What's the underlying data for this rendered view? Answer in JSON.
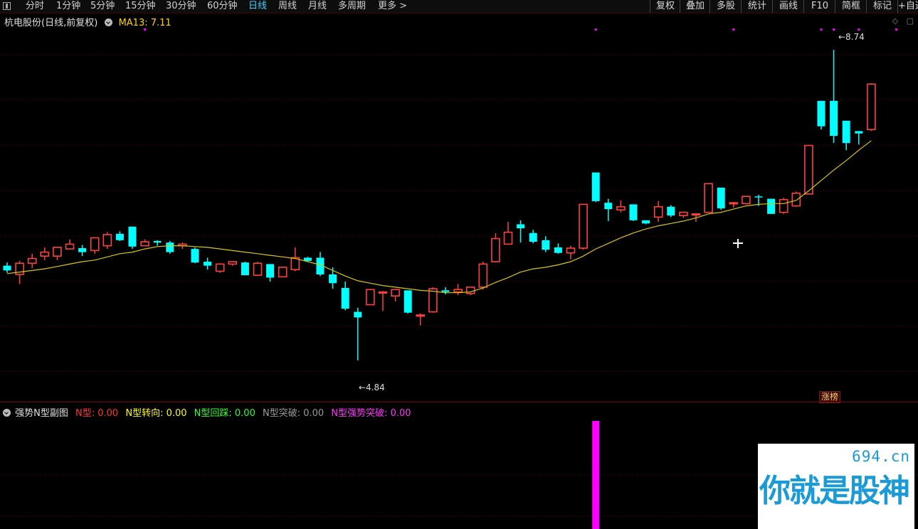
{
  "toolbar": {
    "periods": [
      "分时",
      "1分钟",
      "5分钟",
      "15分钟",
      "30分钟",
      "60分钟",
      "日线",
      "周线",
      "月线",
      "多周期",
      "更多 >"
    ],
    "active_period": "日线",
    "right_buttons": [
      "复权",
      "叠加",
      "多股",
      "统计",
      "画线",
      "F10",
      "简框",
      "标记",
      "+自选"
    ]
  },
  "header": {
    "stock": "杭电股份(日线,前复权)",
    "ma_label": "MA13: 7.11",
    "ma_color": "#ffd700"
  },
  "price_marks": {
    "high": "8.74",
    "low": "4.84"
  },
  "badge": "涨榜",
  "sub": {
    "title": "强势N型副图",
    "indicators": [
      {
        "label": "N型: 0.00",
        "color": "#ff3333"
      },
      {
        "label": "N型转向: 0.00",
        "color": "#ffff00"
      },
      {
        "label": "N型回踩: 0.00",
        "color": "#33ff33"
      },
      {
        "label": "N型突破: 0.00",
        "color": "#9a9a9a"
      },
      {
        "label": "N型强势突破: 0.00",
        "color": "#ff33ff"
      }
    ]
  },
  "watermark": {
    "url": "694.cn",
    "text": "你就是股神"
  },
  "colors": {
    "up": "#ff4040",
    "down": "#00ffff",
    "ma": "#d8c800",
    "grid": "#600000",
    "signal": "#ff00ff"
  },
  "chart_data": {
    "type": "candlestick",
    "price_range": [
      4.6,
      9.0
    ],
    "candles": [
      {
        "o": 6.03,
        "h": 6.07,
        "l": 5.94,
        "c": 5.97
      },
      {
        "o": 5.92,
        "h": 6.09,
        "l": 5.8,
        "c": 6.06
      },
      {
        "o": 6.06,
        "h": 6.18,
        "l": 6.0,
        "c": 6.12
      },
      {
        "o": 6.15,
        "h": 6.26,
        "l": 6.1,
        "c": 6.2
      },
      {
        "o": 6.15,
        "h": 6.24,
        "l": 6.1,
        "c": 6.26
      },
      {
        "o": 6.24,
        "h": 6.36,
        "l": 6.24,
        "c": 6.3
      },
      {
        "o": 6.25,
        "h": 6.29,
        "l": 6.15,
        "c": 6.2
      },
      {
        "o": 6.22,
        "h": 6.38,
        "l": 6.18,
        "c": 6.38
      },
      {
        "o": 6.28,
        "h": 6.45,
        "l": 6.24,
        "c": 6.42
      },
      {
        "o": 6.43,
        "h": 6.46,
        "l": 6.34,
        "c": 6.35
      },
      {
        "o": 6.52,
        "h": 6.52,
        "l": 6.24,
        "c": 6.27
      },
      {
        "o": 6.28,
        "h": 6.36,
        "l": 6.28,
        "c": 6.33
      },
      {
        "o": 6.34,
        "h": 6.35,
        "l": 6.28,
        "c": 6.32
      },
      {
        "o": 6.32,
        "h": 6.34,
        "l": 6.18,
        "c": 6.2
      },
      {
        "o": 6.28,
        "h": 6.32,
        "l": 6.24,
        "c": 6.3
      },
      {
        "o": 6.24,
        "h": 6.26,
        "l": 6.06,
        "c": 6.07
      },
      {
        "o": 6.08,
        "h": 6.13,
        "l": 5.98,
        "c": 6.03
      },
      {
        "o": 5.96,
        "h": 6.06,
        "l": 5.94,
        "c": 6.05
      },
      {
        "o": 6.05,
        "h": 6.08,
        "l": 6.03,
        "c": 6.08
      },
      {
        "o": 6.07,
        "h": 6.08,
        "l": 5.91,
        "c": 5.91
      },
      {
        "o": 5.91,
        "h": 6.08,
        "l": 5.9,
        "c": 6.06
      },
      {
        "o": 6.05,
        "h": 6.05,
        "l": 5.83,
        "c": 5.88
      },
      {
        "o": 5.89,
        "h": 6.01,
        "l": 5.89,
        "c": 6.01
      },
      {
        "o": 5.98,
        "h": 6.26,
        "l": 5.96,
        "c": 6.13
      },
      {
        "o": 6.13,
        "h": 6.14,
        "l": 6.08,
        "c": 6.09
      },
      {
        "o": 6.13,
        "h": 6.2,
        "l": 5.9,
        "c": 5.92
      },
      {
        "o": 5.92,
        "h": 6.01,
        "l": 5.74,
        "c": 5.81
      },
      {
        "o": 5.75,
        "h": 5.83,
        "l": 5.47,
        "c": 5.49
      },
      {
        "o": 5.45,
        "h": 5.5,
        "l": 4.84,
        "c": 5.38
      },
      {
        "o": 5.54,
        "h": 5.72,
        "l": 5.54,
        "c": 5.73
      },
      {
        "o": 5.7,
        "h": 5.71,
        "l": 5.46,
        "c": 5.7
      },
      {
        "o": 5.65,
        "h": 5.72,
        "l": 5.58,
        "c": 5.73
      },
      {
        "o": 5.72,
        "h": 5.72,
        "l": 5.43,
        "c": 5.44
      },
      {
        "o": 5.4,
        "h": 5.43,
        "l": 5.28,
        "c": 5.41
      },
      {
        "o": 5.45,
        "h": 5.76,
        "l": 5.44,
        "c": 5.74
      },
      {
        "o": 5.72,
        "h": 5.76,
        "l": 5.67,
        "c": 5.7
      },
      {
        "o": 5.7,
        "h": 5.8,
        "l": 5.66,
        "c": 5.73
      },
      {
        "o": 5.68,
        "h": 5.75,
        "l": 5.66,
        "c": 5.76
      },
      {
        "o": 5.76,
        "h": 6.08,
        "l": 5.73,
        "c": 6.05
      },
      {
        "o": 6.08,
        "h": 6.44,
        "l": 6.07,
        "c": 6.37
      },
      {
        "o": 6.3,
        "h": 6.58,
        "l": 6.3,
        "c": 6.45
      },
      {
        "o": 6.55,
        "h": 6.6,
        "l": 6.32,
        "c": 6.5
      },
      {
        "o": 6.44,
        "h": 6.48,
        "l": 6.31,
        "c": 6.33
      },
      {
        "o": 6.35,
        "h": 6.4,
        "l": 6.2,
        "c": 6.23
      },
      {
        "o": 6.26,
        "h": 6.31,
        "l": 6.18,
        "c": 6.19
      },
      {
        "o": 6.19,
        "h": 6.28,
        "l": 6.11,
        "c": 6.25
      },
      {
        "o": 6.25,
        "h": 6.8,
        "l": 6.23,
        "c": 6.8
      },
      {
        "o": 7.2,
        "h": 7.2,
        "l": 6.83,
        "c": 6.84
      },
      {
        "o": 6.82,
        "h": 6.87,
        "l": 6.59,
        "c": 6.74
      },
      {
        "o": 6.73,
        "h": 6.85,
        "l": 6.7,
        "c": 6.77
      },
      {
        "o": 6.8,
        "h": 6.8,
        "l": 6.59,
        "c": 6.6
      },
      {
        "o": 6.6,
        "h": 6.6,
        "l": 6.55,
        "c": 6.56
      },
      {
        "o": 6.64,
        "h": 6.84,
        "l": 6.58,
        "c": 6.77
      },
      {
        "o": 6.77,
        "h": 6.79,
        "l": 6.64,
        "c": 6.66
      },
      {
        "o": 6.66,
        "h": 6.71,
        "l": 6.63,
        "c": 6.7
      },
      {
        "o": 6.67,
        "h": 6.67,
        "l": 6.58,
        "c": 6.68
      },
      {
        "o": 6.7,
        "h": 7.06,
        "l": 6.7,
        "c": 7.06
      },
      {
        "o": 7.01,
        "h": 7.01,
        "l": 6.73,
        "c": 6.75
      },
      {
        "o": 6.82,
        "h": 6.83,
        "l": 6.76,
        "c": 6.82
      },
      {
        "o": 6.81,
        "h": 6.9,
        "l": 6.8,
        "c": 6.9
      },
      {
        "o": 6.9,
        "h": 6.92,
        "l": 6.78,
        "c": 6.89
      },
      {
        "o": 6.87,
        "h": 6.87,
        "l": 6.68,
        "c": 6.68
      },
      {
        "o": 6.7,
        "h": 6.88,
        "l": 6.68,
        "c": 6.86
      },
      {
        "o": 6.78,
        "h": 6.96,
        "l": 6.77,
        "c": 6.94
      },
      {
        "o": 6.93,
        "h": 7.54,
        "l": 6.93,
        "c": 7.54
      },
      {
        "o": 8.1,
        "h": 8.1,
        "l": 7.74,
        "c": 7.78
      },
      {
        "o": 8.1,
        "h": 8.74,
        "l": 7.57,
        "c": 7.66
      },
      {
        "o": 7.85,
        "h": 7.85,
        "l": 7.48,
        "c": 7.57
      },
      {
        "o": 7.72,
        "h": 7.72,
        "l": 7.55,
        "c": 7.69
      },
      {
        "o": 7.74,
        "h": 8.32,
        "l": 7.72,
        "c": 8.31
      }
    ],
    "ma13": [
      5.93,
      5.95,
      5.97,
      5.99,
      6.02,
      6.05,
      6.08,
      6.1,
      6.14,
      6.18,
      6.2,
      6.24,
      6.27,
      6.28,
      6.28,
      6.27,
      6.26,
      6.24,
      6.22,
      6.2,
      6.18,
      6.16,
      6.14,
      6.12,
      6.08,
      6.04,
      5.97,
      5.9,
      5.84,
      5.81,
      5.78,
      5.76,
      5.74,
      5.72,
      5.71,
      5.69,
      5.69,
      5.7,
      5.75,
      5.82,
      5.88,
      5.95,
      5.99,
      6.01,
      6.04,
      6.08,
      6.15,
      6.24,
      6.31,
      6.38,
      6.44,
      6.49,
      6.53,
      6.56,
      6.59,
      6.63,
      6.68,
      6.7,
      6.74,
      6.78,
      6.8,
      6.81,
      6.81,
      6.85,
      6.97,
      7.1,
      7.23,
      7.35,
      7.48,
      7.6
    ],
    "signals": [
      48,
      58,
      65,
      66,
      68,
      71
    ]
  }
}
